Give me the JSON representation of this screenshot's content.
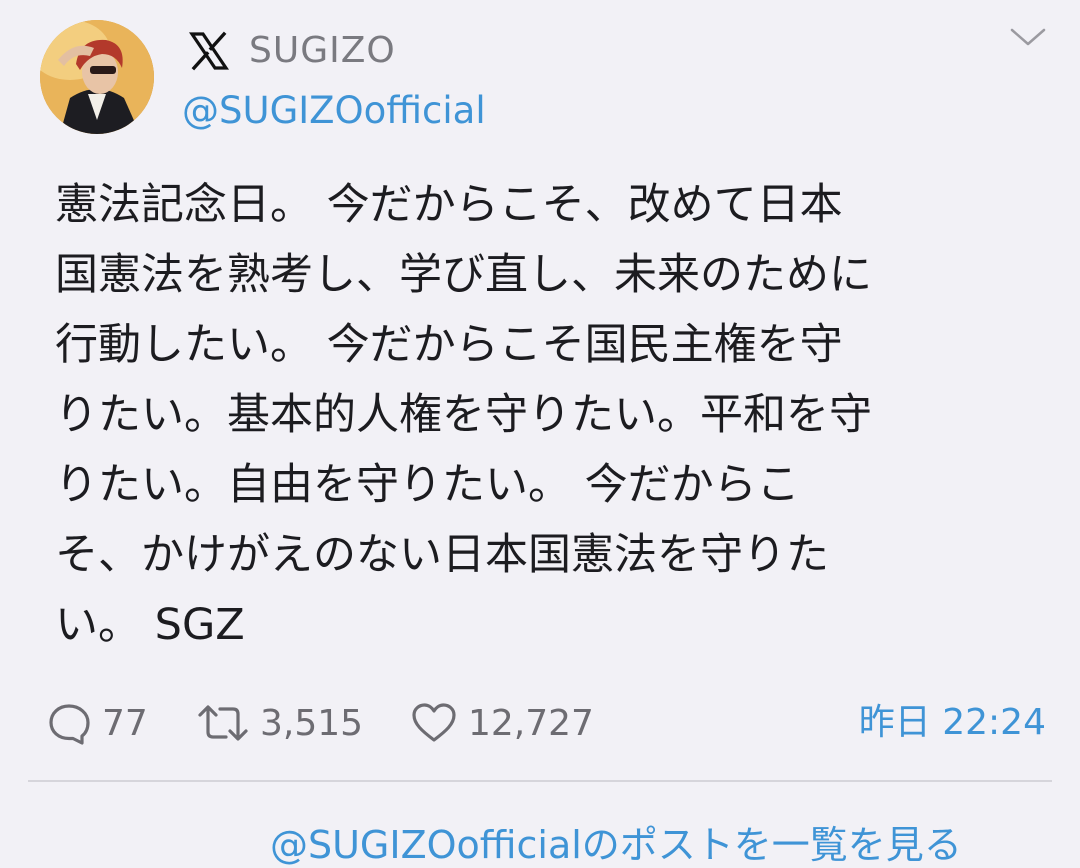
{
  "author": {
    "display_name": "SUGIZO",
    "handle": "@SUGIZOofficial",
    "avatar_icon": "profile-photo",
    "platform_icon": "x-logo-icon"
  },
  "post": {
    "lines": [
      "憲法記念日。 今だからこそ、改めて日本",
      "国憲法を熟考し、学び直し、未来のために",
      "行動したい。 今だからこそ国民主権を守",
      "りたい。基本的人権を守りたい。平和を守",
      "りたい。自由を守りたい。 今だからこ",
      "そ、かけがえのない日本国憲法を守りた",
      "い。 SGZ"
    ]
  },
  "stats": {
    "replies": "77",
    "reposts": "3,515",
    "likes": "12,727"
  },
  "timestamp": "昨日 22:24",
  "footer": {
    "link_text": "@SUGIZOofficialのポストを一覧を見る"
  },
  "colors": {
    "background": "#f2f1f6",
    "text": "#1c1c20",
    "muted": "#6d6c72",
    "accent": "#3f94d6"
  }
}
